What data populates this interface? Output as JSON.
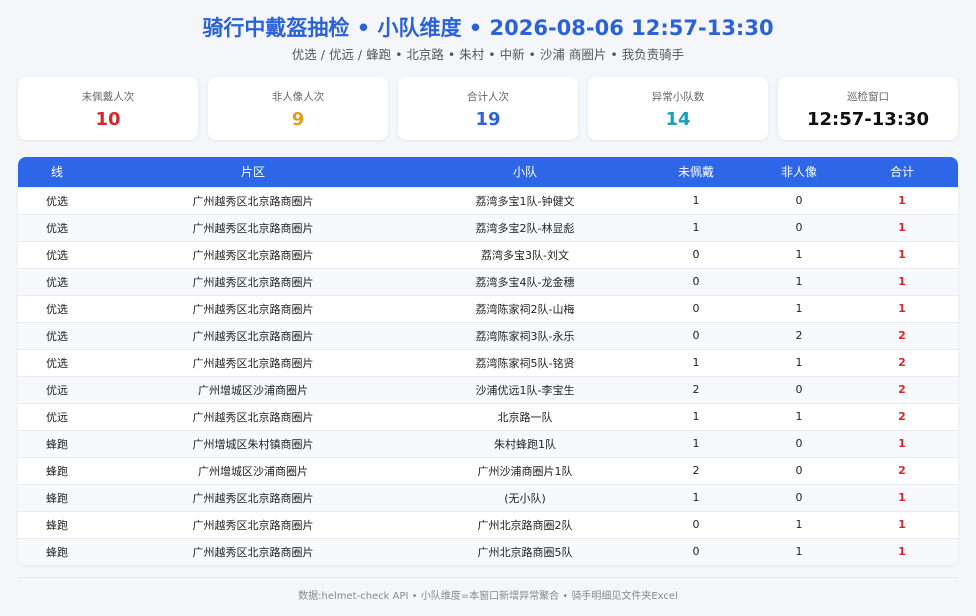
{
  "header": {
    "title": "骑行中戴盔抽检 • 小队维度 • 2026-08-06 12:57-13:30",
    "subtitle": "优选 / 优远 / 蜂跑 • 北京路 • 朱村 • 中新 • 沙浦 商圈片 • 我负责骑手"
  },
  "cards": [
    {
      "label": "未佩戴人次",
      "value": "10",
      "color": "#d62828"
    },
    {
      "label": "非人像人次",
      "value": "9",
      "color": "#e39b1b"
    },
    {
      "label": "合计人次",
      "value": "19",
      "color": "#2a62d8"
    },
    {
      "label": "异常小队数",
      "value": "14",
      "color": "#17a2b8"
    },
    {
      "label": "巡检窗口",
      "value": "12:57-13:30",
      "color": "#111111"
    }
  ],
  "table": {
    "columns": [
      "线",
      "片区",
      "小队",
      "未佩戴",
      "非人像",
      "合计"
    ],
    "rows": [
      [
        "优选",
        "广州越秀区北京路商圈片",
        "荔湾多宝1队-钟健文",
        "1",
        "0",
        "1"
      ],
      [
        "优选",
        "广州越秀区北京路商圈片",
        "荔湾多宝2队-林显彪",
        "1",
        "0",
        "1"
      ],
      [
        "优选",
        "广州越秀区北京路商圈片",
        "荔湾多宝3队-刘文",
        "0",
        "1",
        "1"
      ],
      [
        "优选",
        "广州越秀区北京路商圈片",
        "荔湾多宝4队-龙金穗",
        "0",
        "1",
        "1"
      ],
      [
        "优选",
        "广州越秀区北京路商圈片",
        "荔湾陈家祠2队-山梅",
        "0",
        "1",
        "1"
      ],
      [
        "优选",
        "广州越秀区北京路商圈片",
        "荔湾陈家祠3队-永乐",
        "0",
        "2",
        "2"
      ],
      [
        "优选",
        "广州越秀区北京路商圈片",
        "荔湾陈家祠5队-铭贤",
        "1",
        "1",
        "2"
      ],
      [
        "优远",
        "广州增城区沙浦商圈片",
        "沙浦优远1队-李宝生",
        "2",
        "0",
        "2"
      ],
      [
        "优远",
        "广州越秀区北京路商圈片",
        "北京路一队",
        "1",
        "1",
        "2"
      ],
      [
        "蜂跑",
        "广州增城区朱村镇商圈片",
        "朱村蜂跑1队",
        "1",
        "0",
        "1"
      ],
      [
        "蜂跑",
        "广州增城区沙浦商圈片",
        "广州沙浦商圈片1队",
        "2",
        "0",
        "2"
      ],
      [
        "蜂跑",
        "广州越秀区北京路商圈片",
        "(无小队)",
        "1",
        "0",
        "1"
      ],
      [
        "蜂跑",
        "广州越秀区北京路商圈片",
        "广州北京路商圈2队",
        "0",
        "1",
        "1"
      ],
      [
        "蜂跑",
        "广州越秀区北京路商圈片",
        "广州北京路商圈5队",
        "0",
        "1",
        "1"
      ]
    ]
  },
  "footer": {
    "text": "数据:helmet-check API • 小队维度=本窗口新增异常聚合 • 骑手明细见文件夹Excel"
  }
}
